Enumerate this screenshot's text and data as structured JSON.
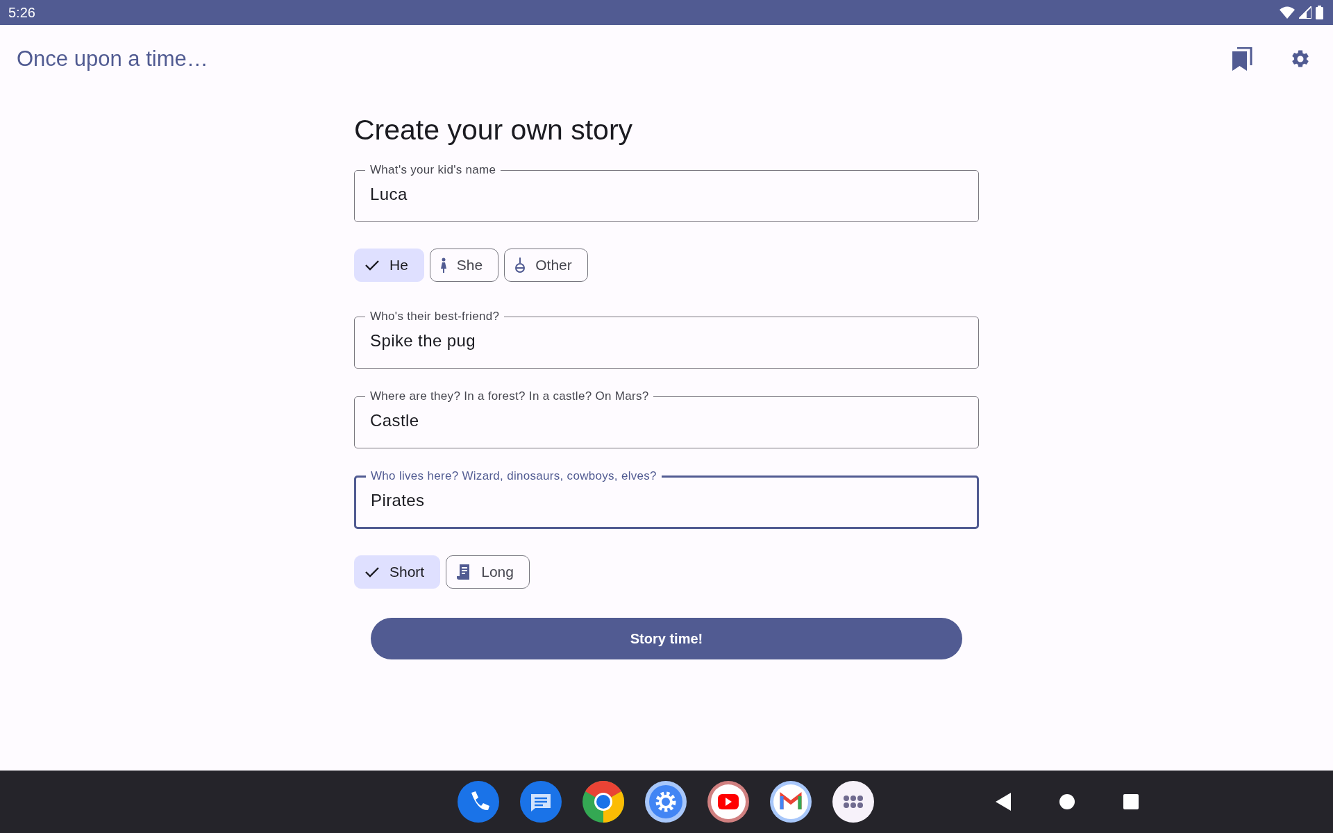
{
  "status_bar": {
    "time": "5:26"
  },
  "app_bar": {
    "title": "Once upon a time…"
  },
  "heading": "Create your own story",
  "sections": [
    {
      "kind": "field",
      "label": "What's your kid's name",
      "value": "Luca",
      "focused": false
    },
    {
      "kind": "chips",
      "chips": [
        {
          "label": "He",
          "selected": true
        },
        {
          "label": "She",
          "selected": false
        },
        {
          "label": "Other",
          "selected": false
        }
      ]
    },
    {
      "kind": "field",
      "label": "Who's their best-friend?",
      "value": "Spike the pug",
      "focused": false
    },
    {
      "kind": "field",
      "label": "Where are they? In a forest? In a castle? On Mars?",
      "value": "Castle",
      "focused": false
    },
    {
      "kind": "field",
      "label": "Who lives here? Wizard, dinosaurs, cowboys, elves?",
      "value": "Pirates",
      "focused": true
    },
    {
      "kind": "chips",
      "chips": [
        {
          "label": "Short",
          "selected": true
        },
        {
          "label": "Long",
          "selected": false
        }
      ]
    }
  ],
  "button": "Story time!"
}
